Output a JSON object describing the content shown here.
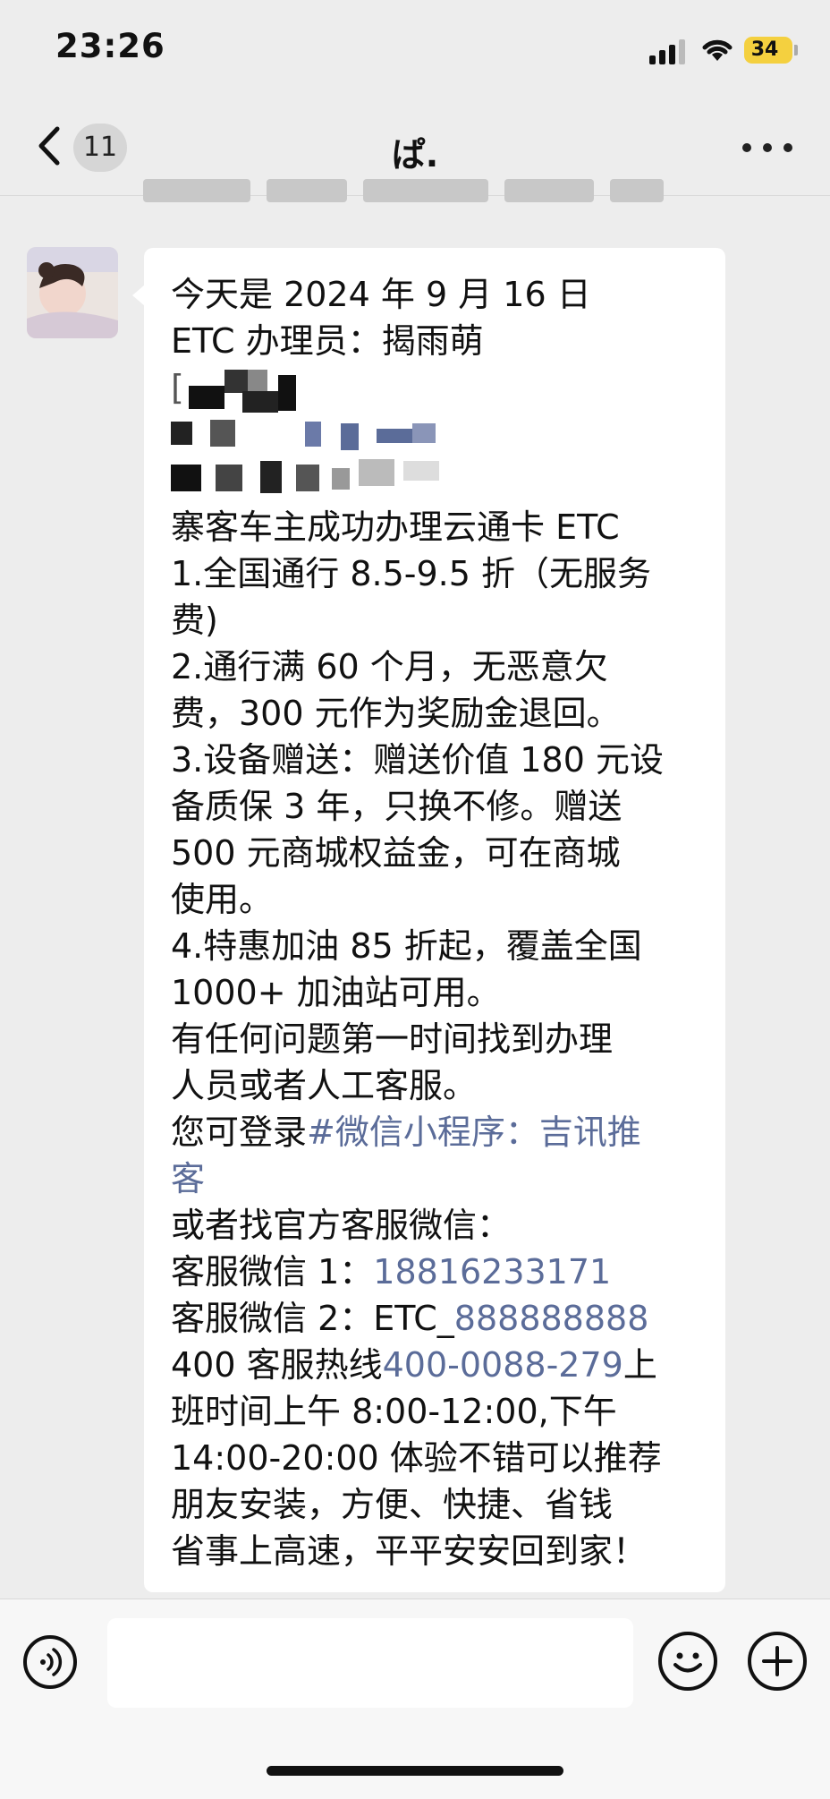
{
  "status_bar": {
    "time": "23:26",
    "battery": "34",
    "battery_icon": "battery-charging-icon",
    "signal_icon": "cellular-signal-icon",
    "wifi_icon": "wifi-icon"
  },
  "nav": {
    "unread_count": "11",
    "title": "ぱ.",
    "back_icon": "chevron-left-icon",
    "more_icon": "more-horizontal-icon"
  },
  "message": {
    "lines": [
      {
        "text": "今天是 2024 年 9 月 16 日"
      },
      {
        "text": "ETC 办理员：揭雨萌"
      },
      {
        "text": "["
      },
      {
        "text": "寨客车主成功办理云通卡 ETC"
      },
      {
        "text": "1.全国通行 8.5-9.5 折（无服务"
      },
      {
        "text": "费)"
      },
      {
        "text": "2.通行满 60 个月，无恶意欠"
      },
      {
        "text": "费，300 元作为奖励金退回。"
      },
      {
        "text": "3.设备赠送：赠送价值 180 元设"
      },
      {
        "text": "备质保 3 年，只换不修。赠送"
      },
      {
        "text": "500 元商城权益金，可在商城"
      },
      {
        "text": "使用。"
      },
      {
        "text": "4.特惠加油 85 折起，覆盖全国"
      },
      {
        "text": "1000+ 加油站可用。"
      },
      {
        "text": "有任何问题第一时间找到办理"
      },
      {
        "text": "人员或者人工客服。"
      },
      {
        "prefix": "您可登录",
        "link": "#微信小程序：吉讯推"
      },
      {
        "link": "客"
      },
      {
        "text": "或者找官方客服微信："
      },
      {
        "prefix": "客服微信 1：",
        "link": "18816233171"
      },
      {
        "prefix": "客服微信 2：ETC_",
        "link": "888888888"
      },
      {
        "prefix": "400 客服热线",
        "link": "400-0088-279",
        "suffix": "上"
      },
      {
        "text": "班时间上午 8:00-12:00,下午"
      },
      {
        "text": "14:00-20:00 体验不错可以推荐"
      },
      {
        "text": "朋友安装，方便、快捷、省钱"
      },
      {
        "text": "省事上高速，平平安安回到家！"
      }
    ]
  },
  "input_bar": {
    "voice_icon": "voice-icon",
    "emoji_icon": "emoji-icon",
    "plus_icon": "plus-icon",
    "placeholder": ""
  }
}
